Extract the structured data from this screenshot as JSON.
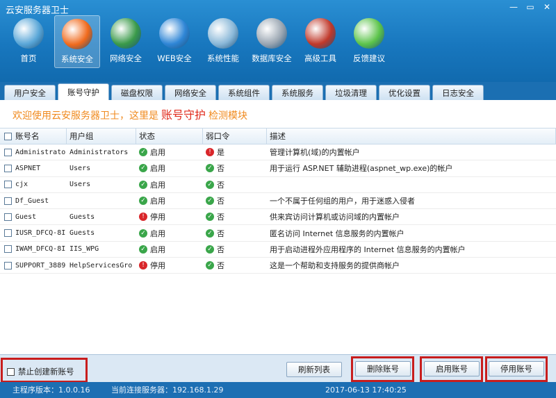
{
  "window": {
    "title": "云安服务器卫士",
    "controls": [
      "—",
      "▭",
      "✕"
    ]
  },
  "toolbar": [
    {
      "label": "首页",
      "icon": "home-globe-icon",
      "color": "#5aa7d8"
    },
    {
      "label": "系统安全",
      "icon": "windows-logo-icon",
      "color": "#f06a1c"
    },
    {
      "label": "网络安全",
      "icon": "globe-icon",
      "color": "#3a9a4a"
    },
    {
      "label": "WEB安全",
      "icon": "internet-explorer-icon",
      "color": "#2f86d6"
    },
    {
      "label": "系统性能",
      "icon": "performance-monitor-icon",
      "color": "#8ab8d8"
    },
    {
      "label": "数据库安全",
      "icon": "database-shield-icon",
      "color": "#9aa6b2"
    },
    {
      "label": "高级工具",
      "icon": "tools-icon",
      "color": "#c0392b"
    },
    {
      "label": "反馈建议",
      "icon": "chat-bubble-icon",
      "color": "#5cc44a"
    }
  ],
  "tabs": [
    "用户安全",
    "账号守护",
    "磁盘权限",
    "网络安全",
    "系统组件",
    "系统服务",
    "垃圾清理",
    "优化设置",
    "日志安全"
  ],
  "welcome": {
    "prefix": "欢迎使用云安服务器卫士，这里是",
    "highlight": "账号守护",
    "suffix": "检测模块"
  },
  "table": {
    "headers": [
      "账号名",
      "用户组",
      "状态",
      "弱口令",
      "描述"
    ],
    "rows": [
      {
        "name": "Administrato",
        "group": "Administrators",
        "status": "启用",
        "status_ok": true,
        "weak": "是",
        "weak_ok": false,
        "desc": "管理计算机(域)的内置帐户"
      },
      {
        "name": "ASPNET",
        "group": "Users",
        "status": "启用",
        "status_ok": true,
        "weak": "否",
        "weak_ok": true,
        "desc": "用于运行 ASP.NET 辅助进程(aspnet_wp.exe)的帐户"
      },
      {
        "name": "cjx",
        "group": "Users",
        "status": "启用",
        "status_ok": true,
        "weak": "否",
        "weak_ok": true,
        "desc": ""
      },
      {
        "name": "Df_Guest",
        "group": "",
        "status": "启用",
        "status_ok": true,
        "weak": "否",
        "weak_ok": true,
        "desc": "一个不属于任何组的用户，用于迷惑入侵者"
      },
      {
        "name": "Guest",
        "group": "Guests",
        "status": "停用",
        "status_ok": false,
        "weak": "否",
        "weak_ok": true,
        "desc": "供来宾访问计算机或访问域的内置帐户"
      },
      {
        "name": "IUSR_DFCQ-8I!",
        "group": "Guests",
        "status": "启用",
        "status_ok": true,
        "weak": "否",
        "weak_ok": true,
        "desc": "匿名访问 Internet 信息服务的内置帐户"
      },
      {
        "name": "IWAM_DFCQ-8I!",
        "group": "IIS_WPG",
        "status": "启用",
        "status_ok": true,
        "weak": "否",
        "weak_ok": true,
        "desc": "用于启动进程外应用程序的 Internet 信息服务的内置帐户"
      },
      {
        "name": "SUPPORT_3889:",
        "group": "HelpServicesGro",
        "status": "停用",
        "status_ok": false,
        "weak": "否",
        "weak_ok": true,
        "desc": "这是一个帮助和支持服务的提供商帐户"
      }
    ]
  },
  "footer": {
    "disable_create": "禁止创建新账号",
    "refresh": "刷新列表",
    "delete": "删除账号",
    "enable": "启用账号",
    "disable": "停用账号"
  },
  "status": {
    "version": "主程序版本：1.0.0.16",
    "server": "当前连接服务器：192.168.1.29",
    "time": "2017-06-13 17:40:25"
  },
  "colors": {
    "brand": "#1877be",
    "ok": "#3aa64a",
    "bad": "#d9262a",
    "highlight_box": "#c81d1d"
  }
}
